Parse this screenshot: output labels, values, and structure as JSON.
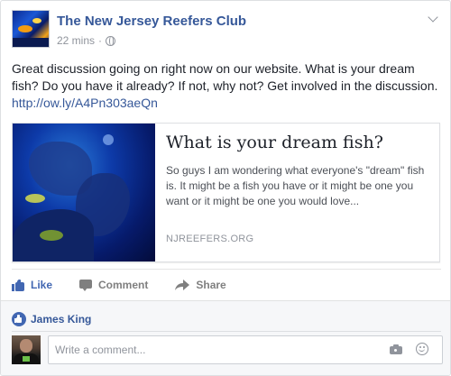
{
  "post": {
    "page_name": "The New Jersey Reefers Club",
    "time": "22 mins",
    "separator": "·",
    "text": "Great discussion going on right now on our website. What is your dream fish? Do you have it already? If not, why not? Get involved in the discussion.",
    "link": "http://ow.ly/A4Pn303aeQn"
  },
  "preview": {
    "title": "What is your dream fish?",
    "description": "So guys I am wondering what everyone's \"dream\" fish is. It might be a fish you have or it might be one you want or it might be one you would love...",
    "domain": "NJREEFERS.ORG"
  },
  "actions": {
    "like": "Like",
    "comment": "Comment",
    "share": "Share"
  },
  "likes": {
    "names": "James King"
  },
  "comment_input": {
    "placeholder": "Write a comment..."
  },
  "colors": {
    "link_blue": "#365899",
    "like_blue": "#4267b2",
    "meta_gray": "#90949c"
  },
  "icons": [
    "globe-icon",
    "chevron-down-icon",
    "like-icon",
    "comment-icon",
    "share-icon",
    "like-badge-icon",
    "camera-icon",
    "emoji-icon"
  ]
}
